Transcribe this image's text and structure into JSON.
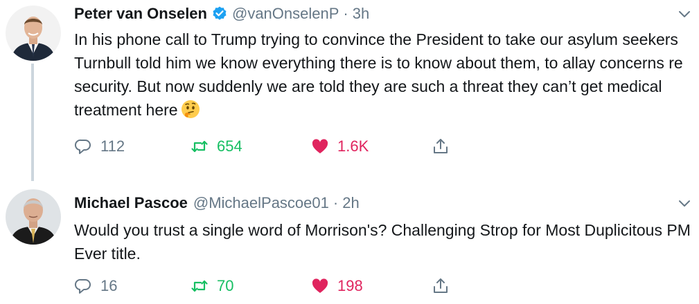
{
  "tweets": [
    {
      "name": "Peter van Onselen",
      "verified": true,
      "handle": "@vanOnselenP",
      "dot": "·",
      "time": "3h",
      "text": "In his phone call to Trump trying to convince the President to take our asylum seekers Turnbull told him we know everything there is to know about them, to allay concerns re security. But now suddenly we are told they are such a threat they can’t get medical treatment here",
      "emoji": "thinking-face",
      "replies": "112",
      "retweets": "654",
      "likes": "1.6K",
      "liked": true,
      "retweeted": true
    },
    {
      "name": "Michael Pascoe",
      "verified": false,
      "handle": "@MichaelPascoe01",
      "dot": "·",
      "time": "2h",
      "text": "Would you trust a single word of Morrison's? Challenging Strop for Most Duplicitous PM Ever  title.",
      "replies": "16",
      "retweets": "70",
      "likes": "198",
      "liked": true,
      "retweeted": true
    }
  ],
  "colors": {
    "text": "#14171a",
    "secondary": "#657786",
    "retweet": "#17bf63",
    "like": "#e0245e",
    "verified": "#1da1f2",
    "thread_line": "#ccd6dd"
  }
}
